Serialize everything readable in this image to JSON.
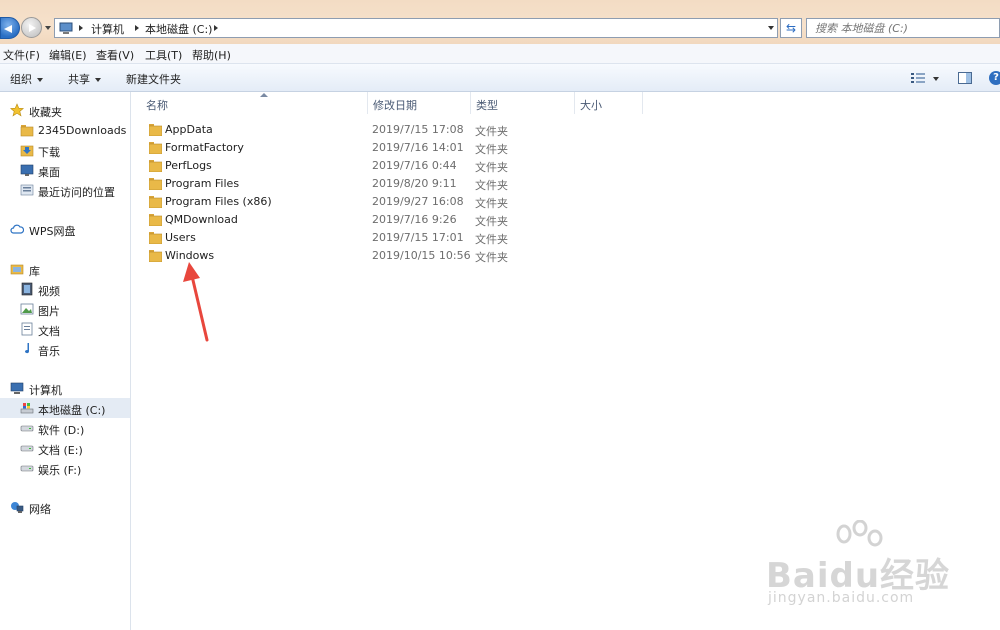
{
  "address": {
    "crumbs": [
      "计算机",
      "本地磁盘 (C:)"
    ],
    "search_placeholder": "搜索 本地磁盘 (C:)"
  },
  "menu": [
    "文件(F)",
    "编辑(E)",
    "查看(V)",
    "工具(T)",
    "帮助(H)"
  ],
  "commands": {
    "organize": "组织",
    "share": "共享",
    "new_folder": "新建文件夹"
  },
  "sidebar": {
    "favorites": {
      "label": "收藏夹",
      "items": [
        "2345Downloads",
        "下载",
        "桌面",
        "最近访问的位置"
      ]
    },
    "wps": "WPS网盘",
    "libraries": {
      "label": "库",
      "items": [
        "视频",
        "图片",
        "文档",
        "音乐"
      ]
    },
    "computer": {
      "label": "计算机",
      "items": [
        "本地磁盘 (C:)",
        "软件 (D:)",
        "文档 (E:)",
        "娱乐 (F:)"
      ]
    },
    "network": "网络"
  },
  "columns": [
    "名称",
    "修改日期",
    "类型",
    "大小"
  ],
  "files": [
    {
      "name": "AppData",
      "date": "2019/7/15 17:08",
      "type": "文件夹"
    },
    {
      "name": "FormatFactory",
      "date": "2019/7/16 14:01",
      "type": "文件夹"
    },
    {
      "name": "PerfLogs",
      "date": "2019/7/16 0:44",
      "type": "文件夹"
    },
    {
      "name": "Program Files",
      "date": "2019/8/20 9:11",
      "type": "文件夹"
    },
    {
      "name": "Program Files (x86)",
      "date": "2019/9/27 16:08",
      "type": "文件夹"
    },
    {
      "name": "QMDownload",
      "date": "2019/7/16 9:26",
      "type": "文件夹"
    },
    {
      "name": "Users",
      "date": "2019/7/15 17:01",
      "type": "文件夹"
    },
    {
      "name": "Windows",
      "date": "2019/10/15 10:56",
      "type": "文件夹"
    }
  ],
  "colors": {
    "annotation_arrow": "#e8473d",
    "folder": "#e9b948"
  },
  "watermark": {
    "brand": "Baidu经验",
    "url": "jingyan.baidu.com"
  }
}
